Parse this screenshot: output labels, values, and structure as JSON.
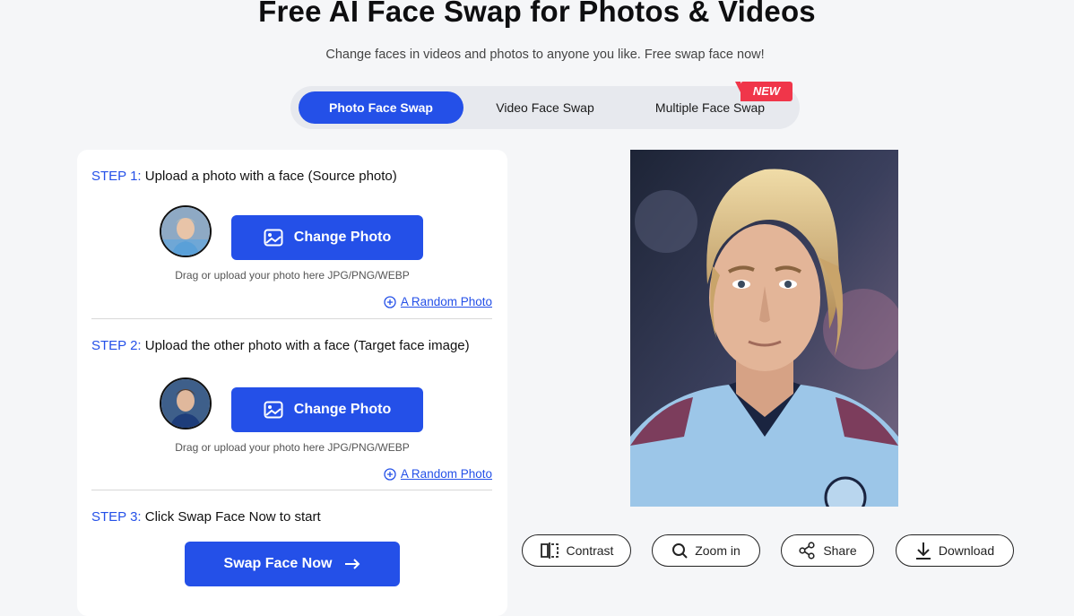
{
  "header": {
    "title": "Free AI Face Swap for Photos & Videos",
    "subtitle": "Change faces in videos and photos to anyone you like. Free swap face now!"
  },
  "tabs": [
    {
      "label": "Photo Face Swap",
      "active": true
    },
    {
      "label": "Video Face Swap",
      "active": false
    },
    {
      "label": "Multiple Face Swap",
      "active": false,
      "badge": "NEW"
    }
  ],
  "steps": {
    "step1": {
      "num": "STEP 1:",
      "text": "Upload a photo with a face (Source photo)",
      "button": "Change Photo",
      "hint": "Drag or upload your photo here JPG/PNG/WEBP",
      "random": "A Random Photo"
    },
    "step2": {
      "num": "STEP 2:",
      "text": "Upload the other photo with a face (Target face image)",
      "button": "Change Photo",
      "hint": "Drag or upload your photo here JPG/PNG/WEBP",
      "random": "A Random Photo"
    },
    "step3": {
      "num": "STEP 3:",
      "text": "Click Swap Face Now to start",
      "button": "Swap Face Now",
      "button_icon": "arrow-right-icon"
    }
  },
  "actions": [
    {
      "label": "Contrast",
      "icon": "compare-icon"
    },
    {
      "label": "Zoom in",
      "icon": "magnifier-icon"
    },
    {
      "label": "Share",
      "icon": "share-icon"
    },
    {
      "label": "Download",
      "icon": "download-icon"
    }
  ],
  "colors": {
    "accent": "#2450e8",
    "badge": "#f0364a",
    "background": "#f5f6f8"
  }
}
